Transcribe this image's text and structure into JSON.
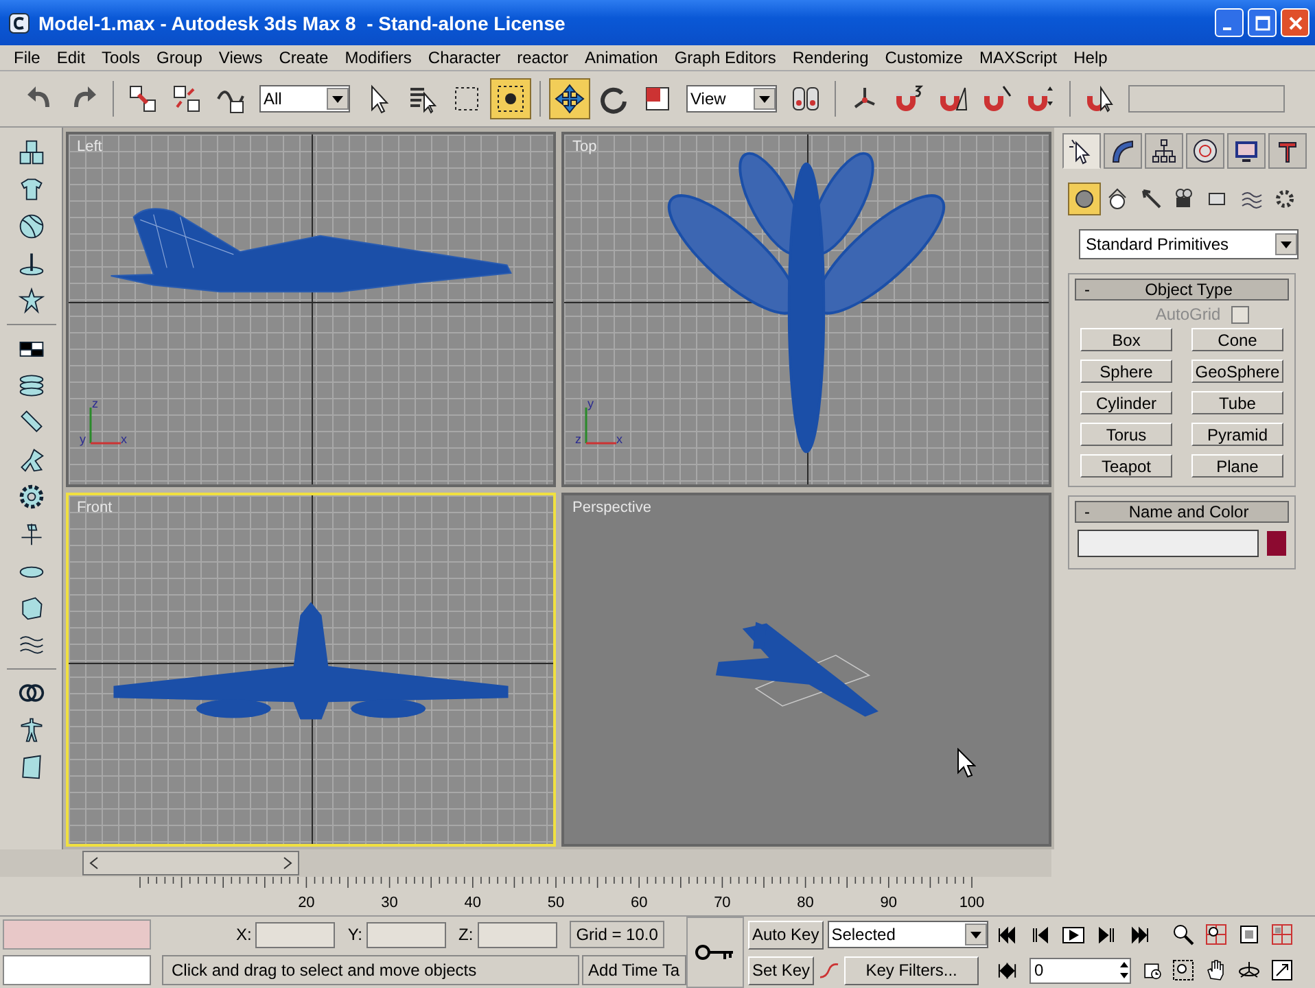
{
  "window": {
    "title": "Model-1.max - Autodesk 3ds Max 8  - Stand-alone License"
  },
  "menu": [
    "File",
    "Edit",
    "Tools",
    "Group",
    "Views",
    "Create",
    "Modifiers",
    "Character",
    "reactor",
    "Animation",
    "Graph Editors",
    "Rendering",
    "Customize",
    "MAXScript",
    "Help"
  ],
  "toolbar": [
    {
      "kind": "undo",
      "selected": false
    },
    {
      "kind": "redo",
      "selected": false
    },
    {
      "kind": "sep"
    },
    {
      "kind": "link",
      "selected": false
    },
    {
      "kind": "unlink",
      "selected": false
    },
    {
      "kind": "bind",
      "selected": false
    },
    {
      "kind": "dropdown",
      "value": "All"
    },
    {
      "kind": "select",
      "selected": false
    },
    {
      "kind": "byname",
      "selected": false
    },
    {
      "kind": "region",
      "selected": false
    },
    {
      "kind": "crossing",
      "selected": true
    },
    {
      "kind": "sep"
    },
    {
      "kind": "move",
      "selected": true
    },
    {
      "kind": "rotate",
      "selected": false
    },
    {
      "kind": "scale",
      "selected": false
    },
    {
      "kind": "dropdown",
      "value": "View"
    },
    {
      "kind": "pivot",
      "selected": false
    },
    {
      "kind": "sep"
    },
    {
      "kind": "constraint",
      "selected": false
    },
    {
      "kind": "snap",
      "selected": false
    },
    {
      "kind": "angle",
      "selected": false
    },
    {
      "kind": "percent",
      "selected": false
    },
    {
      "kind": "spinner",
      "selected": false
    },
    {
      "kind": "sep"
    },
    {
      "kind": "named",
      "selected": false
    },
    {
      "kind": "combo"
    }
  ],
  "viewports": [
    {
      "label": "Left",
      "kind": "left",
      "active": false,
      "axes": [
        "z",
        "y",
        "x"
      ]
    },
    {
      "label": "Top",
      "kind": "top",
      "active": false,
      "axes": [
        "y",
        "z",
        "x"
      ]
    },
    {
      "label": "Front",
      "kind": "front",
      "active": true
    },
    {
      "label": "Perspective",
      "kind": "perspective",
      "active": false
    }
  ],
  "command_panel": {
    "tabs": [
      {
        "kind": "create",
        "selected": true
      },
      {
        "kind": "modify",
        "selected": false
      },
      {
        "kind": "hierarchy",
        "selected": false
      },
      {
        "kind": "motion",
        "selected": false
      },
      {
        "kind": "display",
        "selected": false
      },
      {
        "kind": "utilities",
        "selected": false
      }
    ],
    "categories": [
      {
        "kind": "geometry",
        "selected": true
      },
      {
        "kind": "shapes",
        "selected": false
      },
      {
        "kind": "lights",
        "selected": false
      },
      {
        "kind": "cameras",
        "selected": false
      },
      {
        "kind": "helpers",
        "selected": false
      },
      {
        "kind": "spacewarps",
        "selected": false
      },
      {
        "kind": "systems",
        "selected": false
      }
    ],
    "dropdown": "Standard Primitives",
    "rollouts": [
      {
        "kind": "object_type",
        "toggle": "-",
        "title": "Object Type",
        "autogrid": {
          "label": "AutoGrid",
          "checked": false,
          "disabled": true
        },
        "buttons": [
          "Box",
          "Cone",
          "Sphere",
          "GeoSphere",
          "Cylinder",
          "Tube",
          "Torus",
          "Pyramid",
          "Teapot",
          "Plane"
        ]
      },
      {
        "kind": "name_color",
        "toggle": "-",
        "title": "Name and Color",
        "color": "#8c0a30"
      }
    ]
  },
  "track_bar": {
    "ticks": [
      "20",
      "30",
      "40",
      "50",
      "60",
      "70",
      "80",
      "90",
      "100"
    ]
  },
  "status": {
    "coords": [
      "X:",
      "Y:",
      "Z:"
    ],
    "grid": "Grid = 10.0",
    "prompt": "Click and drag to select and move objects",
    "time_tag": "Add Time Ta",
    "auto_key": "Auto Key",
    "key_dropdown": "Selected",
    "set_key": "Set Key",
    "key_filters": "Key Filters...",
    "frame": "0"
  }
}
